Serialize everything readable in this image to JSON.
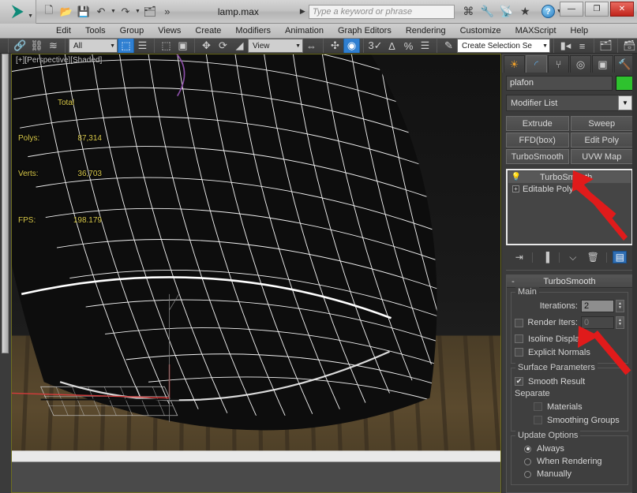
{
  "titlebar": {
    "document": "lamp.max",
    "search_placeholder": "Type a keyword or phrase",
    "logo_glyph": "⮞",
    "qat": [
      {
        "name": "new-file",
        "glyph": "🗋"
      },
      {
        "name": "open-file",
        "glyph": "📂"
      },
      {
        "name": "save-file",
        "glyph": "💾"
      },
      {
        "name": "undo",
        "glyph": "↶"
      },
      {
        "name": "redo",
        "glyph": "↷"
      },
      {
        "name": "set-project-folder",
        "glyph": "🗂"
      },
      {
        "name": "expand-qat",
        "glyph": "»"
      }
    ],
    "title_icons": [
      {
        "name": "search-scene-icon",
        "glyph": "⌘"
      },
      {
        "name": "wrench-icon",
        "glyph": "🔧"
      },
      {
        "name": "satellite-icon",
        "glyph": "📡"
      },
      {
        "name": "favorites-star-icon",
        "glyph": "★"
      }
    ],
    "help_label": "?",
    "window_buttons": {
      "minimize": "—",
      "maximize": "❐",
      "close": "✕"
    }
  },
  "menubar": {
    "items": [
      "Edit",
      "Tools",
      "Group",
      "Views",
      "Create",
      "Modifiers",
      "Animation",
      "Graph Editors",
      "Rendering",
      "Customize",
      "MAXScript",
      "Help"
    ]
  },
  "toolbar": {
    "selection_filter": "All",
    "reference_coord": "View",
    "named_selection_set": "Create Selection Se",
    "icons_left": [
      {
        "name": "select-and-link-icon",
        "glyph": "🔗"
      },
      {
        "name": "unlink-selection-icon",
        "glyph": "⛓"
      },
      {
        "name": "bind-to-space-warp-icon",
        "glyph": "≋"
      }
    ],
    "icons_select": [
      {
        "name": "select-object-icon",
        "glyph": "⬚",
        "active": true
      },
      {
        "name": "select-by-name-icon",
        "glyph": "☰"
      },
      {
        "name": "rectangular-selection-region-icon",
        "glyph": "⬚"
      },
      {
        "name": "window-crossing-icon",
        "glyph": "▣"
      }
    ],
    "icons_transform": [
      {
        "name": "select-and-move-icon",
        "glyph": "✥"
      },
      {
        "name": "select-and-rotate-icon",
        "glyph": "⟳"
      },
      {
        "name": "select-and-scale-icon",
        "glyph": "◢"
      }
    ],
    "icons_snap": [
      {
        "name": "mirror-icon",
        "glyph": "⇔"
      },
      {
        "name": "align-icon",
        "glyph": "✣"
      },
      {
        "name": "use-center-icon",
        "glyph": "◉",
        "active": true
      },
      {
        "name": "snaps-toggle-icon",
        "glyph": "3✓"
      },
      {
        "name": "angle-snap-toggle-icon",
        "glyph": "∆"
      },
      {
        "name": "percent-snap-toggle-icon",
        "glyph": "%"
      },
      {
        "name": "spinner-snap-toggle-icon",
        "glyph": "☰"
      },
      {
        "name": "edit-named-selection-sets-icon",
        "glyph": "✎"
      }
    ],
    "icons_right": [
      {
        "name": "mirror-tool-icon",
        "glyph": "▮◂"
      },
      {
        "name": "align-tool-icon",
        "glyph": "≡"
      },
      {
        "name": "layer-manager-icon",
        "glyph": "🗂"
      },
      {
        "name": "toggle-scene-explorer-icon",
        "glyph": "🗃"
      },
      {
        "name": "curve-editor-icon",
        "glyph": "▦"
      },
      {
        "name": "schematic-view-icon",
        "glyph": "⌸"
      }
    ]
  },
  "viewport": {
    "label": "[+][Perspective][Shaded]",
    "stats": {
      "header": "Total",
      "rows": [
        {
          "label": "Polys:",
          "value": "87,314"
        },
        {
          "label": "Verts:",
          "value": "36,703"
        }
      ],
      "fps_label": "FPS:",
      "fps_value": "198.179"
    }
  },
  "command_panel": {
    "tabs": [
      {
        "name": "create-tab",
        "glyph": "☀",
        "active": false
      },
      {
        "name": "modify-tab",
        "glyph": "◜",
        "active": true
      },
      {
        "name": "hierarchy-tab",
        "glyph": "⑂",
        "active": false
      },
      {
        "name": "motion-tab",
        "glyph": "◎",
        "active": false
      },
      {
        "name": "display-tab",
        "glyph": "▣",
        "active": false
      },
      {
        "name": "utilities-tab",
        "glyph": "🔨",
        "active": false
      }
    ],
    "object_name": "plafon",
    "object_color": "#2ec22e",
    "modifier_list_label": "Modifier List",
    "modifier_buttons": [
      "Extrude",
      "Sweep",
      "FFD(box)",
      "Edit Poly",
      "TurboSmooth",
      "UVW Map"
    ],
    "stack": [
      {
        "label": "TurboSmooth",
        "selected": true
      },
      {
        "label": "Editable Poly",
        "selected": false
      }
    ],
    "stack_tools": [
      {
        "name": "pin-stack-icon",
        "glyph": "⇥"
      },
      {
        "name": "show-end-result-icon",
        "glyph": "▐"
      },
      {
        "name": "make-unique-icon",
        "glyph": "⌵"
      },
      {
        "name": "remove-modifier-icon",
        "glyph": "🗑"
      },
      {
        "name": "configure-modifier-sets-icon",
        "glyph": "▤"
      }
    ],
    "rollout": {
      "title": "TurboSmooth",
      "collapse_glyph": "-",
      "main_group": "Main",
      "iterations_label": "Iterations:",
      "iterations_value": "2",
      "render_iters_label": "Render Iters:",
      "render_iters_value": "0",
      "render_iters_checked": false,
      "isoline_display_label": "Isoline Display",
      "isoline_display_checked": false,
      "explicit_normals_label": "Explicit Normals",
      "explicit_normals_checked": false,
      "surface_group": "Surface Parameters",
      "smooth_result_label": "Smooth Result",
      "smooth_result_checked": true,
      "separate_label": "Separate",
      "materials_label": "Materials",
      "materials_checked": false,
      "smoothing_groups_label": "Smoothing Groups",
      "smoothing_groups_checked": false,
      "update_group": "Update Options",
      "update_options": [
        {
          "label": "Always",
          "selected": true
        },
        {
          "label": "When Rendering",
          "selected": false
        },
        {
          "label": "Manually",
          "selected": false
        }
      ]
    }
  }
}
